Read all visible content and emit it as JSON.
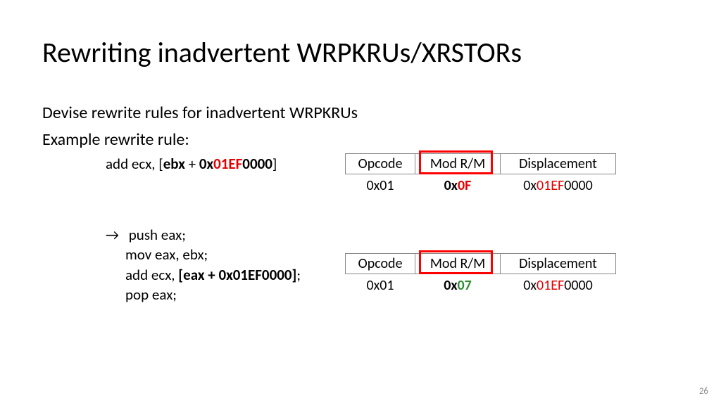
{
  "title": "Rewriting inadvertent WRPKRUs/XRSTORs",
  "intro1": "Devise rewrite rules for inadvertent WRPKRUs",
  "intro2": "Example rewrite rule:",
  "codeA": {
    "pre": "add ecx, [",
    "ebx": "ebx",
    "plus": " + ",
    "hex_pre": "0x",
    "hex_red": "01EF",
    "hex_suf": "0000",
    "close": "]"
  },
  "codeB": {
    "arrow": "→",
    "l1": " push eax;",
    "l2": "mov eax, ebx;",
    "l3_pre": "add ecx, ",
    "l3_bold": "[eax + 0x01EF0000]",
    "l3_semi": ";",
    "l4": "pop eax;"
  },
  "table": {
    "h1": "Opcode",
    "h2": "Mod R/M",
    "h3": "Displacement",
    "op": "0x01",
    "mod_top_pre": "0x",
    "mod_top_val": "0F",
    "mod_bot_pre": "0x",
    "mod_bot_val": "07",
    "disp_pre": "0x",
    "disp_red": "01EF",
    "disp_suf": "0000"
  },
  "page": "26"
}
